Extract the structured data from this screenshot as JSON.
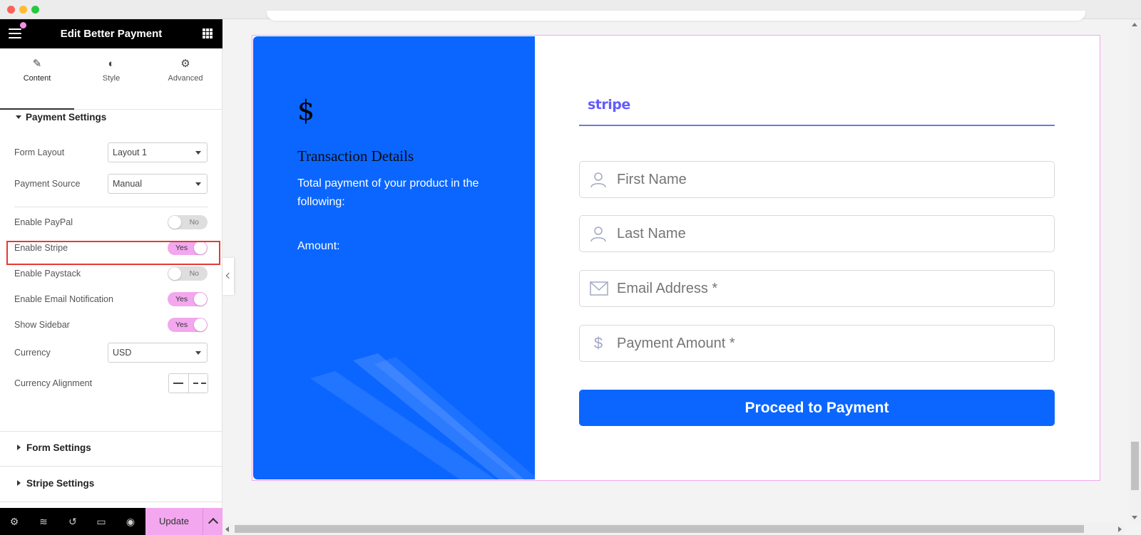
{
  "panel": {
    "title": "Edit Better Payment",
    "tabs": [
      {
        "label": "Content",
        "icon": "pencil-icon"
      },
      {
        "label": "Style",
        "icon": "half-circle-icon"
      },
      {
        "label": "Advanced",
        "icon": "gear-icon"
      }
    ],
    "section_payment": "Payment Settings",
    "form_layout_label": "Form Layout",
    "form_layout_value": "Layout 1",
    "payment_source_label": "Payment Source",
    "payment_source_value": "Manual",
    "toggles": [
      {
        "label": "Enable PayPal",
        "state": "No"
      },
      {
        "label": "Enable Stripe",
        "state": "Yes"
      },
      {
        "label": "Enable Paystack",
        "state": "No"
      },
      {
        "label": "Enable Email Notification",
        "state": "Yes"
      },
      {
        "label": "Show Sidebar",
        "state": "Yes"
      }
    ],
    "currency_label": "Currency",
    "currency_value": "USD",
    "currency_alignment_label": "Currency Alignment",
    "section_form": "Form Settings",
    "section_stripe": "Stripe Settings",
    "update_label": "Update"
  },
  "widget": {
    "currency_symbol": "$",
    "transaction_title": "Transaction Details",
    "transaction_desc": "Total payment of your product in the following:",
    "amount_label": "Amount:",
    "gateway_logo": "stripe",
    "fields": [
      {
        "placeholder": "First Name",
        "icon": "user-icon"
      },
      {
        "placeholder": "Last Name",
        "icon": "user-icon"
      },
      {
        "placeholder": "Email Address *",
        "icon": "envelope-icon"
      },
      {
        "placeholder": "Payment Amount *",
        "icon": "dollar-icon"
      }
    ],
    "submit_label": "Proceed to Payment"
  },
  "colors": {
    "accent_pink": "#f2a7ee",
    "brand_blue": "#0a66ff",
    "stripe_purple": "#635bff",
    "highlight_red": "#e53935"
  }
}
